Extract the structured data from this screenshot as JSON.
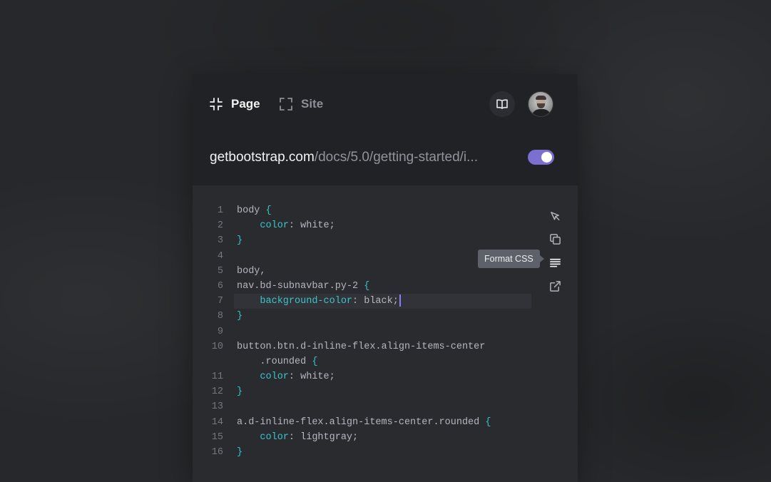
{
  "header": {
    "tabs": [
      {
        "label": "Page",
        "icon": "collapse-icon",
        "active": true
      },
      {
        "label": "Site",
        "icon": "expand-icon",
        "active": false
      }
    ],
    "book_icon": "book-icon",
    "avatar": "user-avatar"
  },
  "url_bar": {
    "domain": "getbootstrap.com",
    "path": "/docs/5.0/getting-started/i...",
    "toggle_on": true,
    "toggle_color": "#7b6fd0"
  },
  "editor": {
    "lines": [
      {
        "n": "1",
        "parts": [
          [
            "sel",
            "body "
          ],
          [
            "brace",
            "{"
          ]
        ]
      },
      {
        "n": "2",
        "parts": [
          [
            "sel",
            "    "
          ],
          [
            "prop",
            "color"
          ],
          [
            "sel",
            ": "
          ],
          [
            "val",
            "white"
          ],
          [
            "sel",
            ";"
          ]
        ]
      },
      {
        "n": "3",
        "parts": [
          [
            "brace",
            "}"
          ]
        ]
      },
      {
        "n": "4",
        "parts": []
      },
      {
        "n": "5",
        "parts": [
          [
            "sel",
            "body,"
          ]
        ]
      },
      {
        "n": "6",
        "parts": [
          [
            "sel",
            "nav.bd-subnavbar.py-2 "
          ],
          [
            "brace",
            "{"
          ]
        ]
      },
      {
        "n": "7",
        "parts": [
          [
            "sel",
            "    "
          ],
          [
            "prop",
            "background-color"
          ],
          [
            "sel",
            ": "
          ],
          [
            "val",
            "black"
          ],
          [
            "sel",
            ";"
          ]
        ],
        "highlight": true,
        "caret": true
      },
      {
        "n": "8",
        "parts": [
          [
            "brace",
            "}"
          ]
        ]
      },
      {
        "n": "9",
        "parts": []
      },
      {
        "n": "10",
        "parts": [
          [
            "sel",
            "button.btn.d-inline-flex.align-items-center"
          ]
        ]
      },
      {
        "n": "",
        "parts": [
          [
            "sel",
            "    .rounded "
          ],
          [
            "brace",
            "{"
          ]
        ]
      },
      {
        "n": "11",
        "parts": [
          [
            "sel",
            "    "
          ],
          [
            "prop",
            "color"
          ],
          [
            "sel",
            ": "
          ],
          [
            "val",
            "white"
          ],
          [
            "sel",
            ";"
          ]
        ]
      },
      {
        "n": "12",
        "parts": [
          [
            "brace",
            "}"
          ]
        ]
      },
      {
        "n": "13",
        "parts": []
      },
      {
        "n": "14",
        "parts": [
          [
            "sel",
            "a.d-inline-flex.align-items-center.rounded "
          ],
          [
            "brace",
            "{"
          ]
        ]
      },
      {
        "n": "15",
        "parts": [
          [
            "sel",
            "    "
          ],
          [
            "prop",
            "color"
          ],
          [
            "sel",
            ": "
          ],
          [
            "val",
            "lightgray"
          ],
          [
            "sel",
            ";"
          ]
        ]
      },
      {
        "n": "16",
        "parts": [
          [
            "brace",
            "}"
          ]
        ]
      }
    ],
    "tools": [
      {
        "name": "select-element-icon"
      },
      {
        "name": "copy-icon"
      },
      {
        "name": "format-icon"
      },
      {
        "name": "external-link-icon"
      }
    ],
    "tooltip": "Format CSS"
  }
}
